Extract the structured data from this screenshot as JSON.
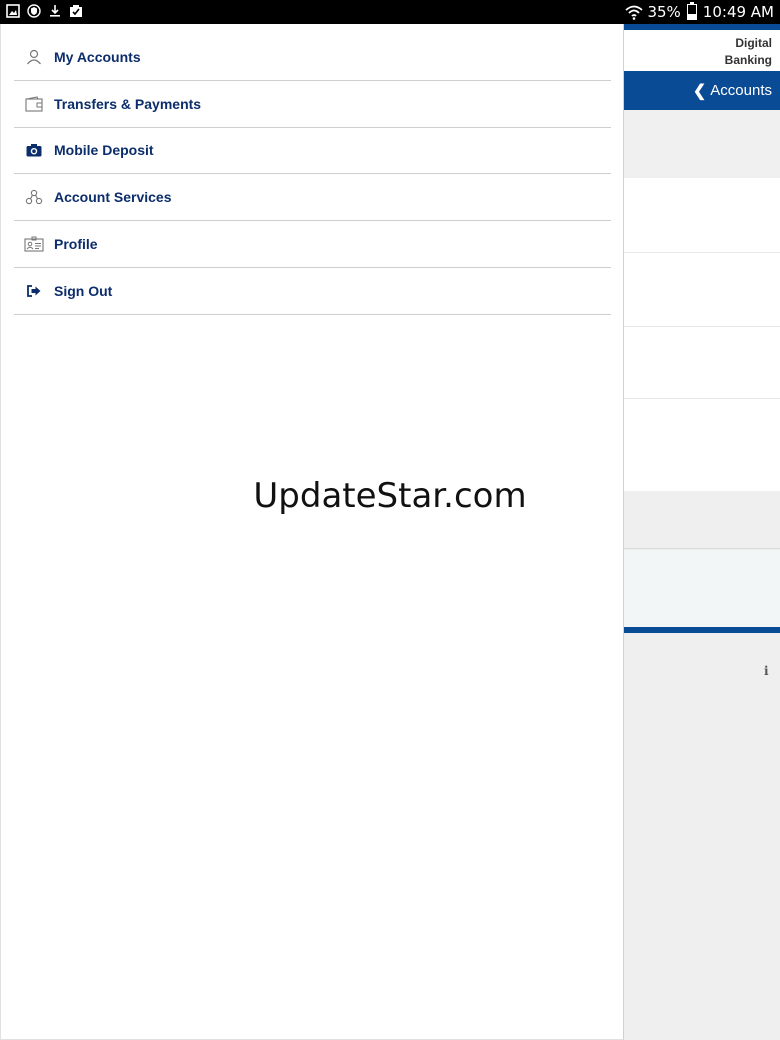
{
  "status_bar": {
    "battery_percent_text": "35%",
    "battery_level": 0.35,
    "time": "10:49 AM",
    "left_icons": [
      "image-icon",
      "shield-icon",
      "download-icon",
      "clipboard-check-icon"
    ],
    "right_icons": [
      "wifi-icon",
      "battery-icon"
    ]
  },
  "drawer": {
    "menu": [
      {
        "label": "My Accounts",
        "icon": "user-icon"
      },
      {
        "label": "Transfers & Payments",
        "icon": "wallet-icon"
      },
      {
        "label": "Mobile Deposit",
        "icon": "camera-icon"
      },
      {
        "label": "Account Services",
        "icon": "services-icon"
      },
      {
        "label": "Profile",
        "icon": "id-card-icon"
      },
      {
        "label": "Sign Out",
        "icon": "sign-out-icon"
      }
    ]
  },
  "background_app": {
    "brand_line1": "Digital",
    "brand_line2": "Banking",
    "back_label": "Accounts",
    "info_icon": "info-icon"
  },
  "watermark": "UpdateStar.com",
  "colors": {
    "brand_blue": "#0a4b96",
    "menu_text": "#0c2d6b"
  }
}
